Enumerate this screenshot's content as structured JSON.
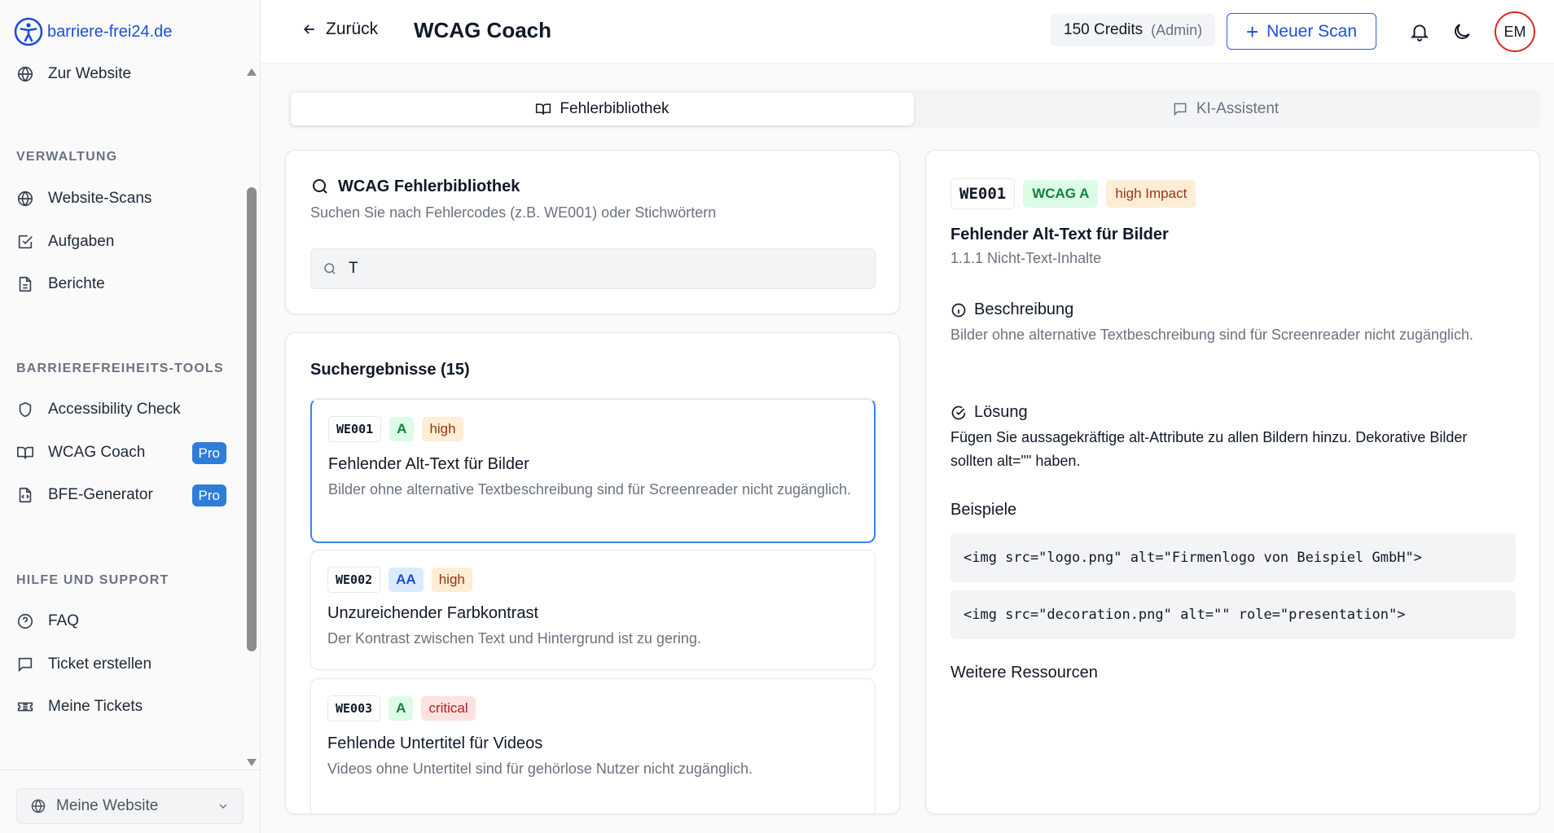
{
  "brand": {
    "name": "barriere-frei24.de"
  },
  "sidebar": {
    "top_item": {
      "label": "Zur Website",
      "icon": "globe-icon"
    },
    "sections": [
      {
        "title": "VERWALTUNG",
        "items": [
          {
            "label": "Website-Scans",
            "icon": "globe-icon"
          },
          {
            "label": "Aufgaben",
            "icon": "checkbox-icon"
          },
          {
            "label": "Berichte",
            "icon": "file-icon"
          }
        ]
      },
      {
        "title": "BARRIEREFREIHEITS-TOOLS",
        "items": [
          {
            "label": "Accessibility Check",
            "icon": "shield-icon"
          },
          {
            "label": "WCAG Coach",
            "icon": "book-icon",
            "badge": "Pro"
          },
          {
            "label": "BFE-Generator",
            "icon": "file-code-icon",
            "badge": "Pro"
          }
        ]
      },
      {
        "title": "HILFE UND SUPPORT",
        "items": [
          {
            "label": "FAQ",
            "icon": "help-circle-icon"
          },
          {
            "label": "Ticket erstellen",
            "icon": "message-square-icon"
          },
          {
            "label": "Meine Tickets",
            "icon": "ticket-icon"
          }
        ]
      }
    ],
    "website_select": {
      "value": "Meine Website"
    }
  },
  "header": {
    "back_label": "Zurück",
    "title": "WCAG Coach",
    "credits": "150 Credits",
    "role": "(Admin)",
    "new_scan_label": "Neuer Scan",
    "new_scan_plus": "+",
    "avatar_initials": "EM"
  },
  "tabs": [
    {
      "label": "Fehlerbibliothek",
      "active": true
    },
    {
      "label": "KI-Assistent",
      "active": false
    }
  ],
  "search": {
    "title": "WCAG Fehlerbibliothek",
    "description": "Suchen Sie nach Fehlercodes (z.B. WE001) oder Stichwörtern",
    "value": "T"
  },
  "results": {
    "title": "Suchergebnisse (15)",
    "items": [
      {
        "code": "WE001",
        "level": "A",
        "impact": "high",
        "title": "Fehlender Alt-Text für Bilder",
        "description": "Bilder ohne alternative Textbeschreibung sind für Screenreader nicht zugänglich."
      },
      {
        "code": "WE002",
        "level": "AA",
        "impact": "high",
        "title": "Unzureichender Farbkontrast",
        "description": "Der Kontrast zwischen Text und Hintergrund ist zu gering."
      },
      {
        "code": "WE003",
        "level": "A",
        "impact": "critical",
        "title": "Fehlende Untertitel für Videos",
        "description": "Videos ohne Untertitel sind für gehörlose Nutzer nicht zugänglich."
      }
    ]
  },
  "detail": {
    "code": "WE001",
    "level": "WCAG A",
    "impact": "high Impact",
    "title": "Fehlender Alt-Text für Bilder",
    "criterion": "1.1.1 Nicht-Text-Inhalte",
    "description_heading": "Beschreibung",
    "description": "Bilder ohne alternative Textbeschreibung sind für Screenreader nicht zugänglich.",
    "solution_heading": "Lösung",
    "solution": "Fügen Sie aussagekräftige alt-Attribute zu allen Bildern hinzu. Dekorative Bilder sollten alt=\"\" haben.",
    "examples_heading": "Beispiele",
    "examples": [
      "<img src=\"logo.png\" alt=\"Firmenlogo von Beispiel GmbH\">",
      "<img src=\"decoration.png\" alt=\"\" role=\"presentation\">"
    ],
    "resources_heading": "Weitere Ressourcen"
  },
  "colors": {
    "accent": "#2563eb",
    "brand": "#1d4ed8",
    "pro_badge": "#2f7dd8",
    "avatar_ring": "#dc2626"
  }
}
